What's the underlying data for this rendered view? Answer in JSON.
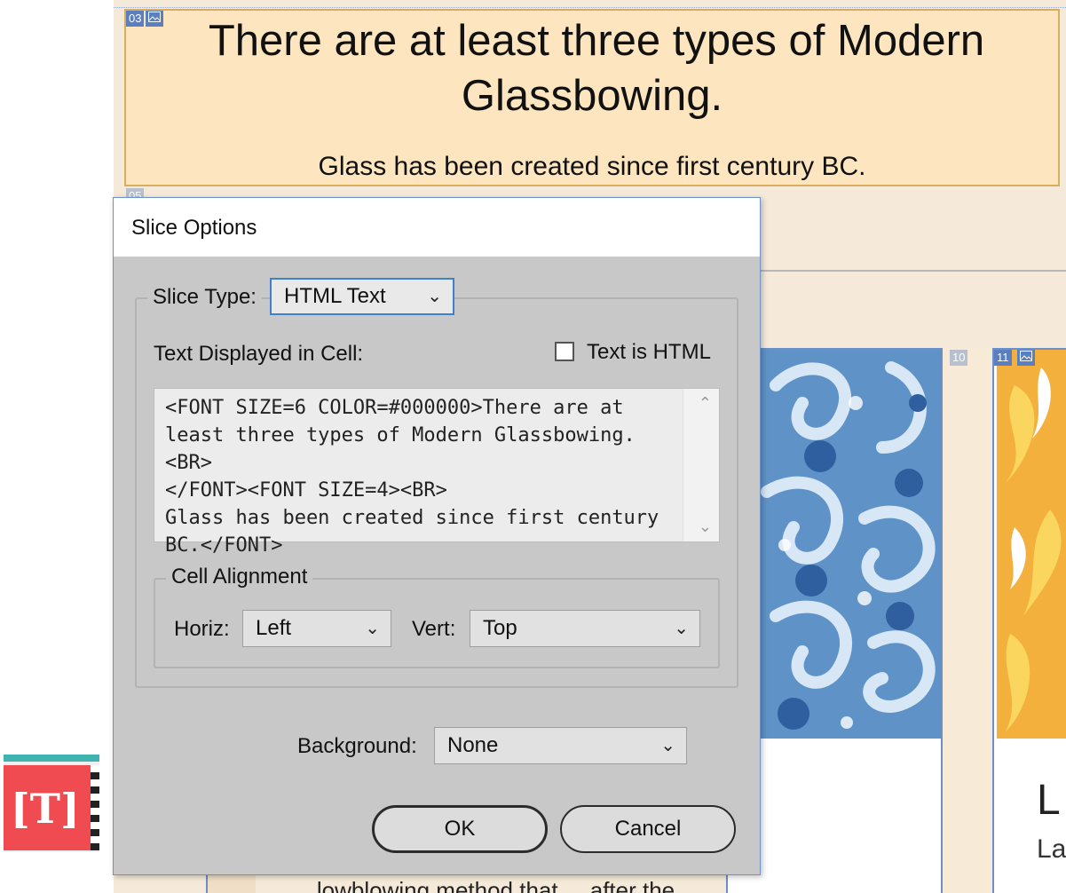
{
  "canvas": {
    "headline_line1": "There are at least three types of Modern",
    "headline_line2": "Glassbowing.",
    "subline": "Glass has been created since first century BC.",
    "slice_top_number": "03",
    "slice_mid_number": "05",
    "slice_col_number_a": "10",
    "slice_col_number_b": "11",
    "right_letter_big": "L",
    "right_letter_small": "La",
    "bottom_text": "... lowblowing method that ... after the"
  },
  "dialog": {
    "title": "Slice Options",
    "slice_type_label": "Slice Type:",
    "slice_type_value": "HTML Text",
    "text_displayed_label": "Text Displayed in Cell:",
    "text_is_html_label": "Text is HTML",
    "text_is_html_checked": false,
    "cell_text": "<FONT SIZE=6 COLOR=#000000>There are at\nleast three types of Modern Glassbowing.<BR>\n</FONT><FONT SIZE=4><BR>\nGlass has been created since first century\nBC.</FONT>",
    "cell_alignment_legend": "Cell Alignment",
    "horiz_label": "Horiz:",
    "horiz_value": "Left",
    "vert_label": "Vert:",
    "vert_value": "Top",
    "background_label": "Background:",
    "background_value": "None",
    "ok_label": "OK",
    "cancel_label": "Cancel"
  },
  "icons": {
    "type_tool_glyph": "[T]",
    "dropdown": "chevron-down-icon",
    "scroll_up": "chevron-up-icon",
    "scroll_down": "chevron-down-icon"
  },
  "colors": {
    "dialog_bg": "#c8c8c8",
    "focus_border": "#3f7fd0",
    "slice_badge": "#5a7fc0",
    "slice_fill": "#fce5bf"
  }
}
